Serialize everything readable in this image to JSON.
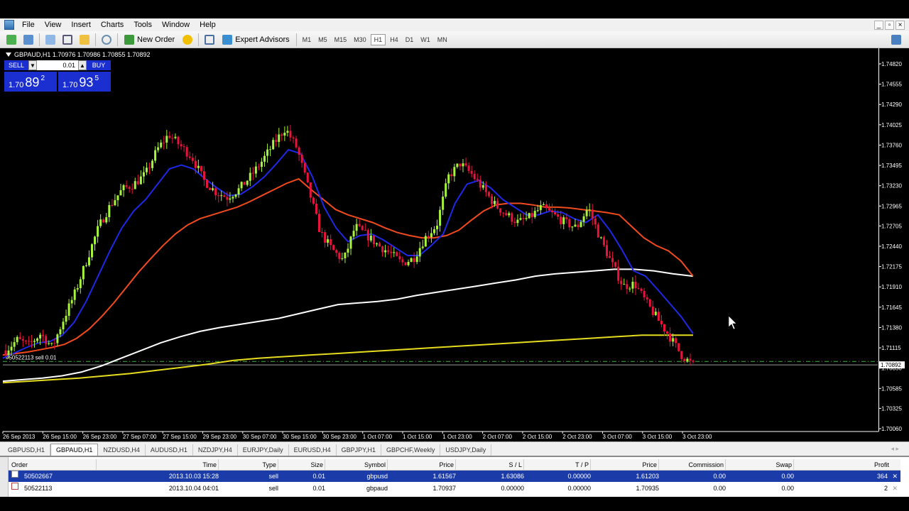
{
  "menu": {
    "items": [
      "File",
      "View",
      "Insert",
      "Charts",
      "Tools",
      "Window",
      "Help"
    ],
    "window_controls": [
      "_",
      "▫",
      "×"
    ]
  },
  "toolbar": {
    "new_order_label": "New Order",
    "expert_advisors_label": "Expert Advisors",
    "timeframes": [
      "M1",
      "M5",
      "M15",
      "M30",
      "H1",
      "H4",
      "D1",
      "W1",
      "MN"
    ],
    "active_timeframe": "H1"
  },
  "chart": {
    "header": "GBPAUD,H1  1.70976 1.70986 1.70855 1.70892",
    "symbol": "GBPAUD",
    "timeframe": "H1",
    "one_click": {
      "sell_label": "SELL",
      "buy_label": "BUY",
      "lot": "0.01",
      "sell_quote": {
        "prefix": "1.70",
        "big": "89",
        "sup": "2"
      },
      "buy_quote": {
        "prefix": "1.70",
        "big": "93",
        "sup": "5"
      }
    },
    "order_line_label": "#50522113 sell 0.01",
    "current_price_label": "1.70892",
    "colors": {
      "background": "#000000",
      "bull_candle": "#a8f43c",
      "bear_candle": "#e8143c",
      "ma_fast": "#1e28e6",
      "ma_mid": "#f04a1e",
      "ma_slow": "#ffffff",
      "ma_long": "#e6dc1e",
      "order_line": "#3cb43c"
    }
  },
  "chart_data": {
    "type": "candlestick",
    "title": "GBPAUD,H1",
    "y_ticks": [
      "1.74820",
      "1.74555",
      "1.74290",
      "1.74025",
      "1.73760",
      "1.73495",
      "1.73230",
      "1.72965",
      "1.72705",
      "1.72440",
      "1.72175",
      "1.71910",
      "1.71645",
      "1.71380",
      "1.71115",
      "1.70850",
      "1.70585",
      "1.70325",
      "1.70060"
    ],
    "y_tick_values": [
      1.7482,
      1.74555,
      1.7429,
      1.74025,
      1.7376,
      1.73495,
      1.7323,
      1.72965,
      1.72705,
      1.7244,
      1.72175,
      1.7191,
      1.71645,
      1.7138,
      1.71115,
      1.7085,
      1.70585,
      1.70325,
      1.7006
    ],
    "x_ticks": [
      "26 Sep 2013",
      "26 Sep 15:00",
      "26 Sep 23:00",
      "27 Sep 07:00",
      "27 Sep 15:00",
      "29 Sep 23:00",
      "30 Sep 07:00",
      "30 Sep 15:00",
      "30 Sep 23:00",
      "1 Oct 07:00",
      "1 Oct 15:00",
      "1 Oct 23:00",
      "2 Oct 07:00",
      "2 Oct 15:00",
      "2 Oct 23:00",
      "3 Oct 07:00",
      "3 Oct 15:00",
      "3 Oct 23:00"
    ],
    "ylim": [
      1.7006,
      1.7482
    ],
    "close_path": [
      1.7108,
      1.7122,
      1.7115,
      1.713,
      1.7112,
      1.715,
      1.7185,
      1.7228,
      1.727,
      1.7298,
      1.7318,
      1.7325,
      1.7338,
      1.737,
      1.739,
      1.7375,
      1.736,
      1.733,
      1.7315,
      1.7308,
      1.7318,
      1.7335,
      1.7355,
      1.7378,
      1.7398,
      1.7372,
      1.7318,
      1.7262,
      1.724,
      1.7225,
      1.727,
      1.7258,
      1.7245,
      1.7235,
      1.7222,
      1.7228,
      1.7255,
      1.7272,
      1.7335,
      1.7352,
      1.7338,
      1.7318,
      1.7298,
      1.7285,
      1.7275,
      1.7282,
      1.7295,
      1.7285,
      1.7275,
      1.7268,
      1.7295,
      1.7255,
      1.7222,
      1.7192,
      1.7195,
      1.717,
      1.7148,
      1.7126,
      1.7102,
      1.7089
    ],
    "ma_fast": [
      1.7098,
      1.7105,
      1.7112,
      1.7118,
      1.712,
      1.7128,
      1.7145,
      1.7172,
      1.7205,
      1.7238,
      1.7268,
      1.729,
      1.7305,
      1.7325,
      1.7345,
      1.735,
      1.7345,
      1.7332,
      1.732,
      1.731,
      1.7312,
      1.7322,
      1.7335,
      1.7352,
      1.737,
      1.7365,
      1.7335,
      1.7295,
      1.7268,
      1.725,
      1.7258,
      1.726,
      1.7252,
      1.7242,
      1.7232,
      1.7232,
      1.7245,
      1.726,
      1.73,
      1.7325,
      1.733,
      1.732,
      1.7305,
      1.7295,
      1.7285,
      1.7285,
      1.729,
      1.7288,
      1.728,
      1.7275,
      1.7285,
      1.7265,
      1.724,
      1.7212,
      1.7205,
      1.7188,
      1.717,
      1.7152,
      1.713
    ],
    "ma_mid": [
      1.7102,
      1.7104,
      1.7106,
      1.7109,
      1.7112,
      1.7116,
      1.7124,
      1.7136,
      1.7152,
      1.717,
      1.719,
      1.721,
      1.7228,
      1.7245,
      1.726,
      1.7272,
      1.728,
      1.7285,
      1.729,
      1.7295,
      1.7302,
      1.731,
      1.7318,
      1.7326,
      1.7332,
      1.7318,
      1.7305,
      1.7292,
      1.7285,
      1.728,
      1.7275,
      1.7268,
      1.7262,
      1.7258,
      1.7255,
      1.7255,
      1.7258,
      1.7265,
      1.7278,
      1.729,
      1.7298,
      1.73,
      1.73,
      1.7298,
      1.7295,
      1.7295,
      1.7294,
      1.7292,
      1.729,
      1.7288,
      1.7285,
      1.727,
      1.7255,
      1.7245,
      1.7238,
      1.7225,
      1.7205
    ],
    "ma_slow": [
      1.7068,
      1.707,
      1.7072,
      1.7075,
      1.708,
      1.7088,
      1.7098,
      1.7108,
      1.7118,
      1.7126,
      1.7133,
      1.7138,
      1.7142,
      1.7146,
      1.715,
      1.7156,
      1.7162,
      1.7168,
      1.717,
      1.7172,
      1.7175,
      1.718,
      1.7184,
      1.7188,
      1.7192,
      1.7196,
      1.72,
      1.7205,
      1.7208,
      1.721,
      1.7212,
      1.7214,
      1.7214,
      1.7212,
      1.7208,
      1.7205
    ],
    "ma_long": [
      1.7066,
      1.7068,
      1.707,
      1.7072,
      1.7075,
      1.7078,
      1.7082,
      1.7086,
      1.709,
      1.7095,
      1.7098,
      1.71,
      1.7102,
      1.7104,
      1.7106,
      1.7108,
      1.711,
      1.7112,
      1.7114,
      1.7116,
      1.7118,
      1.712,
      1.7122,
      1.7124,
      1.7126,
      1.7128,
      1.7128,
      1.7128
    ],
    "order_line_price": 1.70937,
    "current_price": 1.70892
  },
  "chart_tabs": [
    "GBPUSD,H1",
    "GBPAUD,H1",
    "NZDUSD,H4",
    "AUDUSD,H1",
    "NZDJPY,H4",
    "EURJPY,Daily",
    "EURUSD,H4",
    "GBPJPY,H1",
    "GBPCHF,Weekly",
    "USDJPY,Daily"
  ],
  "active_chart_tab": "GBPAUD,H1",
  "terminal": {
    "columns": [
      "Order",
      "Time",
      "Type",
      "Size",
      "Symbol",
      "Price",
      "S / L",
      "T / P",
      "Price",
      "Commission",
      "Swap",
      "Profit"
    ],
    "rows": [
      {
        "order": "50502667",
        "time": "2013.10.03 15:28",
        "type": "sell",
        "size": "0.01",
        "symbol": "gbpusd",
        "price": "1.61567",
        "sl": "1.63086",
        "tp": "0.00000",
        "cur_price": "1.61203",
        "commission": "0.00",
        "swap": "0.00",
        "profit": "364"
      },
      {
        "order": "50522113",
        "time": "2013.10.04 04:01",
        "type": "sell",
        "size": "0.01",
        "symbol": "gbpaud",
        "price": "1.70937",
        "sl": "0.00000",
        "tp": "0.00000",
        "cur_price": "1.70935",
        "commission": "0.00",
        "swap": "0.00",
        "profit": "2"
      }
    ]
  }
}
